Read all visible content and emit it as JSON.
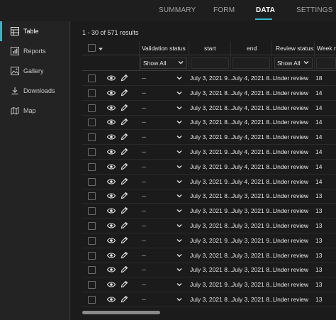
{
  "tabs": [
    {
      "label": "SUMMARY",
      "active": false
    },
    {
      "label": "FORM",
      "active": false
    },
    {
      "label": "DATA",
      "active": true
    },
    {
      "label": "SETTINGS",
      "active": false
    }
  ],
  "sidebar": {
    "items": [
      {
        "label": "Table",
        "icon": "table-icon",
        "active": true
      },
      {
        "label": "Reports",
        "icon": "reports-icon",
        "active": false
      },
      {
        "label": "Gallery",
        "icon": "gallery-icon",
        "active": false
      },
      {
        "label": "Downloads",
        "icon": "downloads-icon",
        "active": false
      },
      {
        "label": "Map",
        "icon": "map-icon",
        "active": false
      }
    ]
  },
  "results": "1 - 30 of 571 results",
  "columns": {
    "validation": "Validation status",
    "start": "start",
    "end": "end",
    "review": "Review status:",
    "week": "Week no"
  },
  "filters": {
    "validation": "Show All",
    "review": "Show All"
  },
  "rows": [
    {
      "validation": "--",
      "start": "July 3, 2021 9...",
      "end": "July 4, 2021 8...",
      "review": "Under review",
      "week": "18"
    },
    {
      "validation": "--",
      "start": "July 3, 2021 8...",
      "end": "July 4, 2021 8...",
      "review": "Under review",
      "week": "14"
    },
    {
      "validation": "--",
      "start": "July 3, 2021 8...",
      "end": "July 4, 2021 8...",
      "review": "Under review",
      "week": "14"
    },
    {
      "validation": "--",
      "start": "July 3, 2021 8...",
      "end": "July 4, 2021 8...",
      "review": "Under review",
      "week": "14"
    },
    {
      "validation": "--",
      "start": "July 3, 2021 9...",
      "end": "July 4, 2021 8...",
      "review": "Under review",
      "week": "14"
    },
    {
      "validation": "--",
      "start": "July 3, 2021 9...",
      "end": "July 4, 2021 8...",
      "review": "Under review",
      "week": "14"
    },
    {
      "validation": "--",
      "start": "July 3, 2021 9...",
      "end": "July 4, 2021 8...",
      "review": "Under review",
      "week": "14"
    },
    {
      "validation": "--",
      "start": "July 3, 2021 9...",
      "end": "July 4, 2021 8...",
      "review": "Under review",
      "week": "14"
    },
    {
      "validation": "--",
      "start": "July 3, 2021 8...",
      "end": "July 3, 2021 9...",
      "review": "Under review",
      "week": "13"
    },
    {
      "validation": "--",
      "start": "July 3, 2021 9...",
      "end": "July 3, 2021 9...",
      "review": "Under review",
      "week": "13"
    },
    {
      "validation": "--",
      "start": "July 3, 2021 8...",
      "end": "July 3, 2021 9...",
      "review": "Under review",
      "week": "13"
    },
    {
      "validation": "--",
      "start": "July 3, 2021 9...",
      "end": "July 3, 2021 9...",
      "review": "Under review",
      "week": "13"
    },
    {
      "validation": "--",
      "start": "July 3, 2021 8...",
      "end": "July 3, 2021 8...",
      "review": "Under review",
      "week": "13"
    },
    {
      "validation": "--",
      "start": "July 3, 2021 8...",
      "end": "July 3, 2021 8...",
      "review": "Under review",
      "week": "13"
    },
    {
      "validation": "--",
      "start": "July 3, 2021 9...",
      "end": "July 3, 2021 8...",
      "review": "Under review",
      "week": "13"
    },
    {
      "validation": "--",
      "start": "July 3, 2021 8...",
      "end": "July 3, 2021 8...",
      "review": "Under review",
      "week": "13"
    }
  ]
}
